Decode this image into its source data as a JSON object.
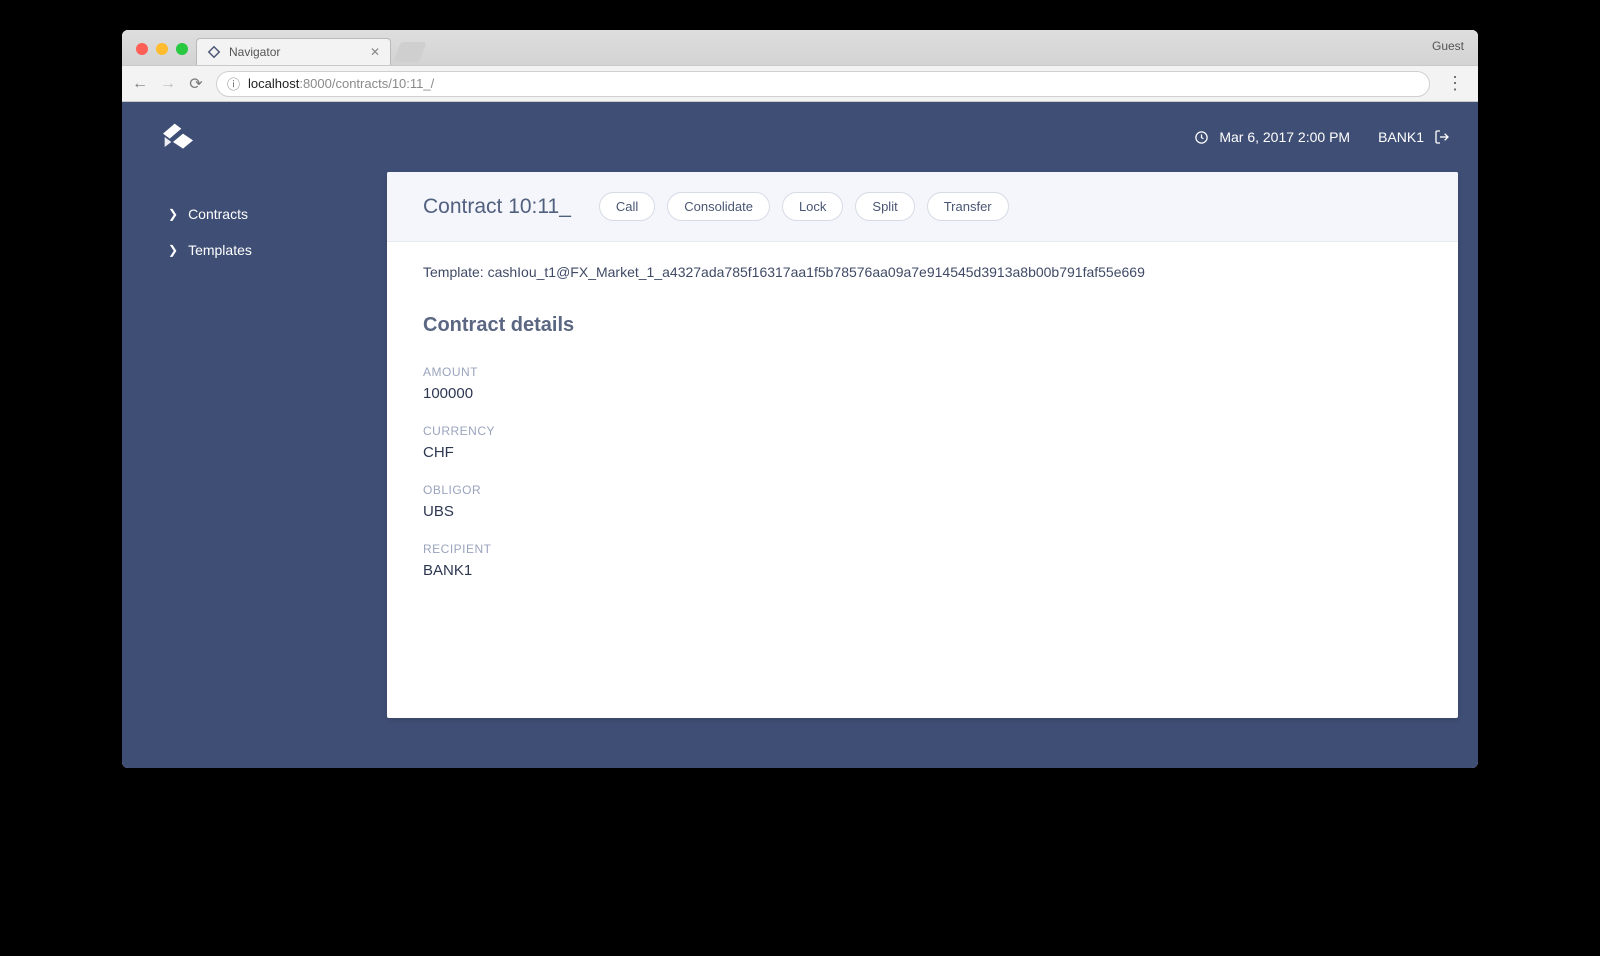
{
  "browser": {
    "tab_title": "Navigator",
    "guest_label": "Guest",
    "url_host": "localhost",
    "url_port_path": ":8000/contracts/10:11_/"
  },
  "topbar": {
    "timestamp": "Mar 6, 2017 2:00 PM",
    "user": "BANK1"
  },
  "sidebar": {
    "items": [
      {
        "label": "Contracts"
      },
      {
        "label": "Templates"
      }
    ]
  },
  "contract": {
    "title": "Contract 10:11_",
    "actions": [
      {
        "label": "Call"
      },
      {
        "label": "Consolidate"
      },
      {
        "label": "Lock"
      },
      {
        "label": "Split"
      },
      {
        "label": "Transfer"
      }
    ],
    "template_prefix": "Template: ",
    "template_id": "cashIou_t1@FX_Market_1_a4327ada785f16317aa1f5b78576aa09a7e914545d3913a8b00b791faf55e669",
    "details_heading": "Contract details",
    "fields": [
      {
        "label": "AMOUNT",
        "value": "100000"
      },
      {
        "label": "CURRENCY",
        "value": "CHF"
      },
      {
        "label": "OBLIGOR",
        "value": "UBS"
      },
      {
        "label": "RECIPIENT",
        "value": "BANK1"
      }
    ]
  }
}
